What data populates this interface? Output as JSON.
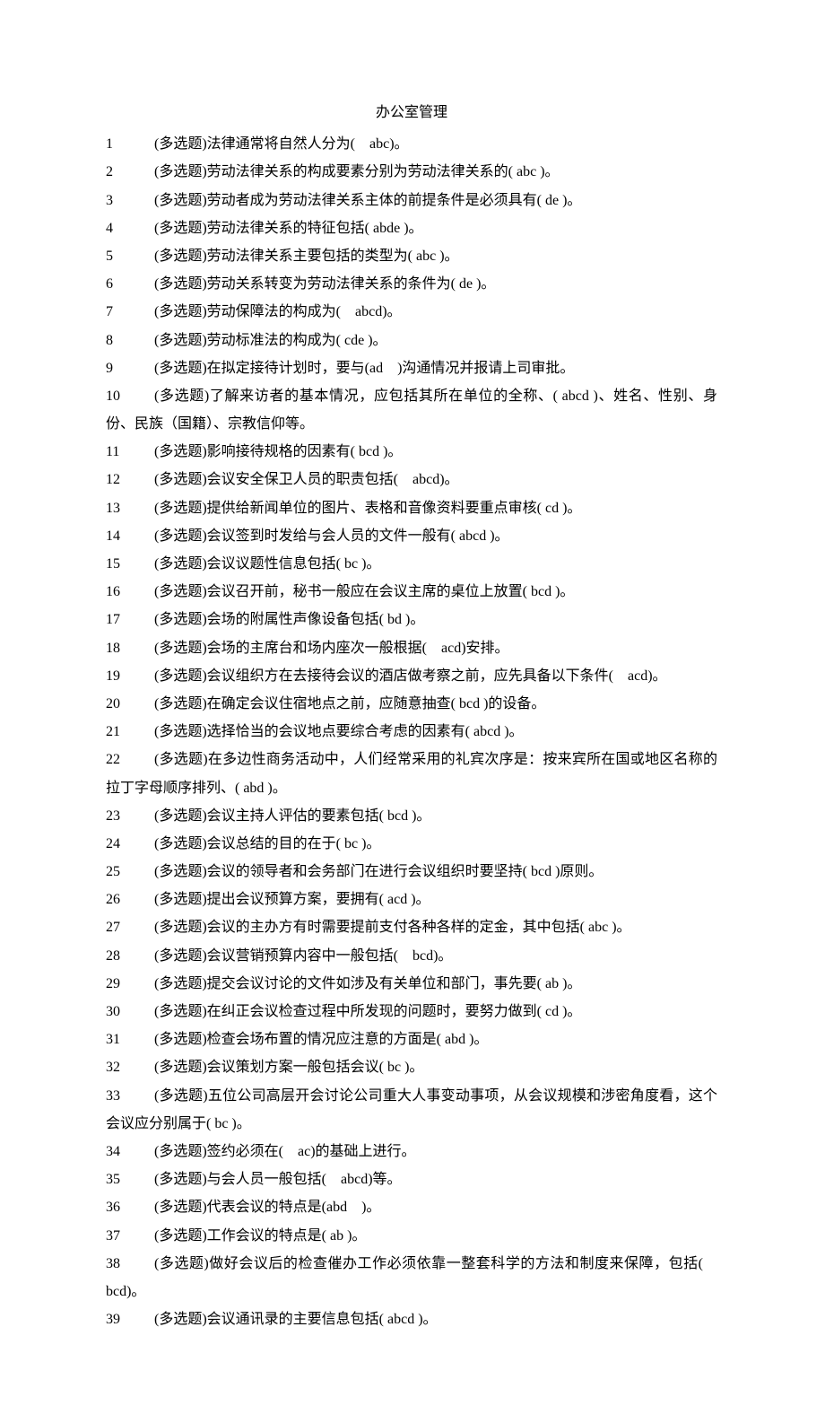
{
  "title": "办公室管理",
  "items": [
    {
      "n": "1",
      "t": "(多选题)法律通常将自然人分为( abc)。"
    },
    {
      "n": "2",
      "t": "(多选题)劳动法律关系的构成要素分别为劳动法律关系的( abc )。"
    },
    {
      "n": "3",
      "t": "(多选题)劳动者成为劳动法律关系主体的前提条件是必须具有( de )。"
    },
    {
      "n": "4",
      "t": "(多选题)劳动法律关系的特征包括( abde )。"
    },
    {
      "n": "5",
      "t": "(多选题)劳动法律关系主要包括的类型为( abc )。"
    },
    {
      "n": "6",
      "t": "(多选题)劳动关系转变为劳动法律关系的条件为( de )。"
    },
    {
      "n": "7",
      "t": "(多选题)劳动保障法的构成为( abcd)。"
    },
    {
      "n": "8",
      "t": "(多选题)劳动标准法的构成为( cde )。"
    },
    {
      "n": "9",
      "t": "(多选题)在拟定接待计划时，要与(ad )沟通情况并报请上司审批。"
    },
    {
      "n": "10",
      "t": "(多选题)了解来访者的基本情况，应包括其所在单位的全称、( abcd )、姓名、性别、身份、民族（国籍）、宗教信仰等。",
      "hang": true
    },
    {
      "n": "11",
      "t": "(多选题)影响接待规格的因素有( bcd )。"
    },
    {
      "n": "12",
      "t": "(多选题)会议安全保卫人员的职责包括( abcd)。"
    },
    {
      "n": "13",
      "t": "(多选题)提供给新闻单位的图片、表格和音像资料要重点审核( cd )。"
    },
    {
      "n": "14",
      "t": "(多选题)会议签到时发给与会人员的文件一般有( abcd )。"
    },
    {
      "n": "15",
      "t": "(多选题)会议议题性信息包括( bc )。"
    },
    {
      "n": "16",
      "t": "(多选题)会议召开前，秘书一般应在会议主席的桌位上放置( bcd )。"
    },
    {
      "n": "17",
      "t": "(多选题)会场的附属性声像设备包括( bd )。"
    },
    {
      "n": "18",
      "t": "(多选题)会场的主席台和场内座次一般根据( acd)安排。"
    },
    {
      "n": "19",
      "t": "(多选题)会议组织方在去接待会议的酒店做考察之前，应先具备以下条件( acd)。"
    },
    {
      "n": "20",
      "t": "(多选题)在确定会议住宿地点之前，应随意抽查( bcd )的设备。"
    },
    {
      "n": "21",
      "t": "(多选题)选择恰当的会议地点要综合考虑的因素有( abcd )。"
    },
    {
      "n": "22",
      "t": "(多选题)在多边性商务活动中，人们经常采用的礼宾次序是：按来宾所在国或地区名称的拉丁字母顺序排列、( abd )。",
      "hang": true
    },
    {
      "n": "23",
      "t": "(多选题)会议主持人评估的要素包括( bcd )。"
    },
    {
      "n": "24",
      "t": "(多选题)会议总结的目的在于( bc )。"
    },
    {
      "n": "25",
      "t": "(多选题)会议的领导者和会务部门在进行会议组织时要坚持( bcd )原则。"
    },
    {
      "n": "26",
      "t": "(多选题)提出会议预算方案，要拥有( acd )。"
    },
    {
      "n": "27",
      "t": "(多选题)会议的主办方有时需要提前支付各种各样的定金，其中包括( abc )。"
    },
    {
      "n": "28",
      "t": "(多选题)会议营销预算内容中一般包括( bcd)。"
    },
    {
      "n": "29",
      "t": "(多选题)提交会议讨论的文件如涉及有关单位和部门，事先要( ab )。"
    },
    {
      "n": "30",
      "t": "(多选题)在纠正会议检查过程中所发现的问题时，要努力做到( cd )。"
    },
    {
      "n": "31",
      "t": "(多选题)检查会场布置的情况应注意的方面是( abd )。"
    },
    {
      "n": "32",
      "t": "(多选题)会议策划方案一般包括会议( bc )。"
    },
    {
      "n": "33",
      "t": "(多选题)五位公司高层开会讨论公司重大人事变动事项，从会议规模和涉密角度看，这个会议应分别属于( bc )。",
      "hang": true
    },
    {
      "n": "34",
      "t": "(多选题)签约必须在( ac)的基础上进行。"
    },
    {
      "n": "35",
      "t": "(多选题)与会人员一般包括( abcd)等。"
    },
    {
      "n": "36",
      "t": "(多选题)代表会议的特点是(abd )。"
    },
    {
      "n": "37",
      "t": "(多选题)工作会议的特点是( ab )。"
    },
    {
      "n": "38",
      "t": "(多选题)做好会议后的检查催办工作必须依靠一整套科学的方法和制度来保障，包括( bcd)。",
      "hang": true
    },
    {
      "n": "39",
      "t": "(多选题)会议通讯录的主要信息包括( abcd )。"
    }
  ]
}
